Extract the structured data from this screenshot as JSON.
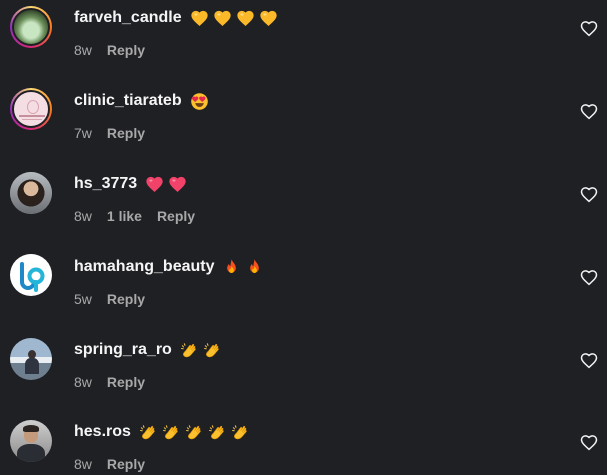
{
  "comments": [
    {
      "username": "farveh_candle",
      "emoji": "yellow-heart",
      "emoji_count": 4,
      "time": "8w",
      "likes": "",
      "reply": "Reply"
    },
    {
      "username": "clinic_tiarateb",
      "emoji": "heart-eyes",
      "emoji_count": 1,
      "time": "7w",
      "likes": "",
      "reply": "Reply"
    },
    {
      "username": "hs_3773",
      "emoji": "pink-heart",
      "emoji_count": 2,
      "time": "8w",
      "likes": "1 like",
      "reply": "Reply"
    },
    {
      "username": "hamahang_beauty",
      "emoji": "fire",
      "emoji_count": 2,
      "time": "5w",
      "likes": "",
      "reply": "Reply"
    },
    {
      "username": "spring_ra_ro",
      "emoji": "clapping-hands",
      "emoji_count": 2,
      "time": "8w",
      "likes": "",
      "reply": "Reply"
    },
    {
      "username": "hes.ros",
      "emoji": "clapping-hands",
      "emoji_count": 5,
      "time": "8w",
      "likes": "",
      "reply": "Reply"
    }
  ],
  "icons": {
    "like": "heart-outline-icon"
  },
  "colors": {
    "background": "#1f2024",
    "username": "#f5f5f5",
    "meta": "#a8a8a8"
  }
}
